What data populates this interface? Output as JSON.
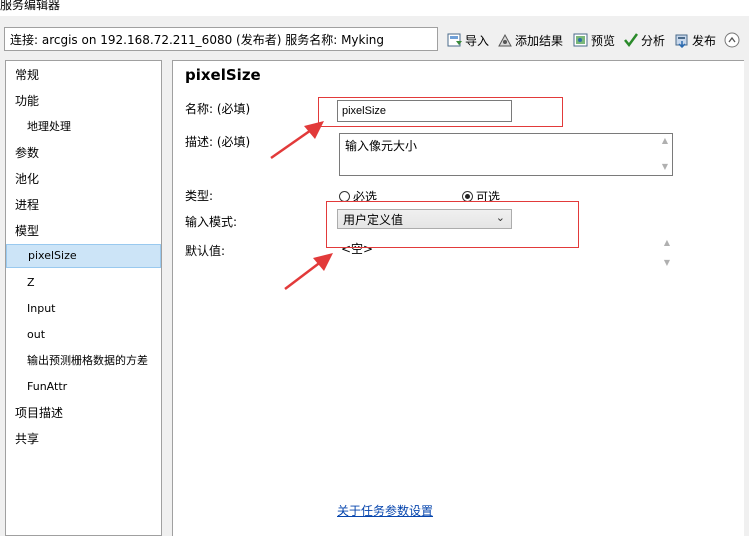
{
  "window": {
    "title": "服务编辑器"
  },
  "toolbar": {
    "connection": "连接: arcgis on 192.168.72.211_6080 (发布者)    服务名称: Myking",
    "import_label": "导入",
    "add_result_label": "添加结果",
    "preview_label": "预览",
    "analyze_label": "分析",
    "publish_label": "发布"
  },
  "nav": {
    "items": [
      {
        "label": "常规",
        "level": 0
      },
      {
        "label": "功能",
        "level": 0
      },
      {
        "label": "地理处理",
        "level": 1
      },
      {
        "label": "参数",
        "level": 0
      },
      {
        "label": "池化",
        "level": 0
      },
      {
        "label": "进程",
        "level": 0
      },
      {
        "label": "模型",
        "level": 0
      },
      {
        "label": "pixelSize",
        "level": 1,
        "selected": true
      },
      {
        "label": "Z",
        "level": 1
      },
      {
        "label": "Input",
        "level": 1
      },
      {
        "label": "out",
        "level": 1
      },
      {
        "label": "输出预测栅格数据的方差",
        "level": 1
      },
      {
        "label": "FunAttr",
        "level": 1
      },
      {
        "label": "项目描述",
        "level": 0
      },
      {
        "label": "共享",
        "level": 0
      }
    ]
  },
  "param": {
    "title": "pixelSize",
    "name_label": "名称: (必填)",
    "name_value": "pixelSize",
    "desc_label": "描述: (必填)",
    "desc_value": "输入像元大小",
    "type_label": "类型:",
    "type_required": "必选",
    "type_optional": "可选",
    "type_selected": "optional",
    "input_mode_label": "输入模式:",
    "input_mode_value": "用户定义值",
    "default_label": "默认值:",
    "default_value": "<空>",
    "link_text": "关于任务参数设置"
  },
  "colors": {
    "annotation": "#e23a3a",
    "selection": "#cce4f7",
    "link": "#0645ad"
  }
}
